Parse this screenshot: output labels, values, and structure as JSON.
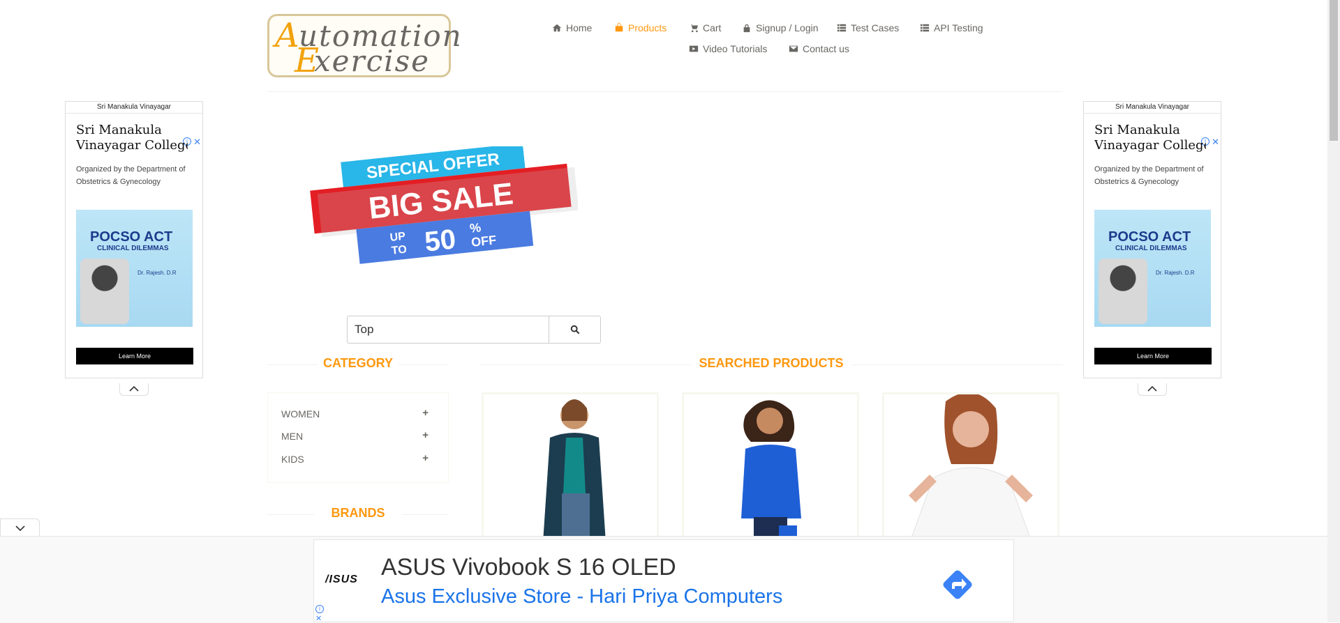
{
  "logo": {
    "line1_cap": "A",
    "line1_rest": "utomation",
    "line2_cap": "E",
    "line2_rest": "xercise"
  },
  "nav": {
    "items": [
      {
        "label": "Home",
        "icon": "home-icon"
      },
      {
        "label": "Products",
        "icon": "shopping-bag-icon",
        "active": true
      },
      {
        "label": "Cart",
        "icon": "cart-icon"
      },
      {
        "label": "Signup / Login",
        "icon": "lock-icon"
      },
      {
        "label": "Test Cases",
        "icon": "list-icon"
      },
      {
        "label": "API Testing",
        "icon": "list-icon"
      },
      {
        "label": "Video Tutorials",
        "icon": "youtube-icon"
      },
      {
        "label": "Contact us",
        "icon": "envelope-icon"
      }
    ]
  },
  "side_ad": {
    "header": "Sri Manakula Vinayagar",
    "title_line1": "Sri Manakula",
    "title_line2": "Vinayagar College",
    "description": "Organized by the Department of Obstetrics & Gynecology",
    "poster_title": "POCSO ACT",
    "poster_subtitle": "CLINICAL DILEMMAS",
    "poster_speaker": "Dr. Rajesh. D.R",
    "cta": "Learn More"
  },
  "banner": {
    "line1": "SPECIAL OFFER",
    "line2": "BIG SALE",
    "line3_a": "UP",
    "line3_b": "TO",
    "line3_c": "50",
    "line3_d": "%",
    "line3_e": "OFF"
  },
  "search": {
    "value": "Top",
    "icon": "search-icon"
  },
  "sidebar": {
    "category_title": "CATEGORY",
    "categories": [
      "WOMEN",
      "MEN",
      "KIDS"
    ],
    "brands_title": "BRANDS"
  },
  "main": {
    "title": "SEARCHED PRODUCTS"
  },
  "bottom_ad": {
    "brand": "/ISUS",
    "headline": "ASUS Vivobook S 16 OLED",
    "subline": "Asus Exclusive Store - Hari Priya Computers"
  },
  "colors": {
    "accent": "#FE980F",
    "text": "#696763",
    "ad_link": "#1a73e8"
  }
}
